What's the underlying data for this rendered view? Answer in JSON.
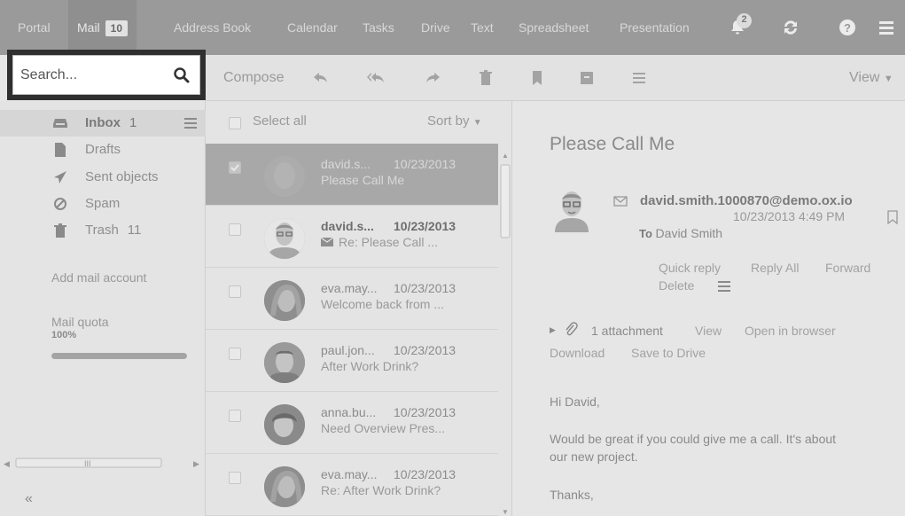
{
  "topnav": {
    "portal": "Portal",
    "mail": "Mail",
    "mail_count": "10",
    "address_book": "Address Book",
    "calendar": "Calendar",
    "tasks": "Tasks",
    "drive": "Drive",
    "text": "Text",
    "spreadsheet": "Spreadsheet",
    "presentation": "Presentation",
    "notification_count": "2",
    "icons": [
      "bell-icon",
      "refresh-icon",
      "help-icon",
      "menu-icon"
    ]
  },
  "search": {
    "placeholder": "Search..."
  },
  "toolbar": {
    "compose": "Compose",
    "view": "View",
    "icons": [
      "reply-icon",
      "reply-all-icon",
      "forward-icon",
      "delete-icon",
      "flag-icon",
      "archive-icon",
      "more-icon"
    ]
  },
  "sidebar": {
    "folders": [
      {
        "label": "Inbox",
        "count": "1",
        "icon": "inbox-icon"
      },
      {
        "label": "Drafts",
        "count": "",
        "icon": "draft-icon"
      },
      {
        "label": "Sent objects",
        "count": "",
        "icon": "sent-icon"
      },
      {
        "label": "Spam",
        "count": "",
        "icon": "spam-icon"
      },
      {
        "label": "Trash",
        "count": "11",
        "icon": "trash-icon"
      }
    ],
    "add_account": "Add mail account",
    "quota_label": "Mail quota",
    "quota_value": "100%",
    "quota_fraction": 1.0,
    "collapse": "«"
  },
  "list": {
    "select_all": "Select all",
    "sort_by": "Sort by",
    "messages": [
      {
        "from": "david.s...",
        "date": "10/23/2013",
        "subject": "Please Call Me",
        "selected": true,
        "unread": false,
        "checked": true
      },
      {
        "from": "david.s...",
        "date": "10/23/2013",
        "subject": "Re: Please Call ...",
        "selected": false,
        "unread": true,
        "checked": false
      },
      {
        "from": "eva.may...",
        "date": "10/23/2013",
        "subject": "Welcome back from ...",
        "selected": false,
        "unread": false,
        "checked": false
      },
      {
        "from": "paul.jon...",
        "date": "10/23/2013",
        "subject": "After Work Drink?",
        "selected": false,
        "unread": false,
        "checked": false
      },
      {
        "from": "anna.bu...",
        "date": "10/23/2013",
        "subject": "Need Overview Pres...",
        "selected": false,
        "unread": false,
        "checked": false
      },
      {
        "from": "eva.may...",
        "date": "10/23/2013",
        "subject": "Re: After Work Drink?",
        "selected": false,
        "unread": false,
        "checked": false
      }
    ]
  },
  "detail": {
    "subject": "Please Call Me",
    "from": "david.smith.1000870@demo.ox.io",
    "datetime": "10/23/2013 4:49 PM",
    "to_label": "To",
    "to": "David Smith",
    "actions": {
      "quick_reply": "Quick reply",
      "reply_all": "Reply All",
      "forward": "Forward",
      "delete": "Delete"
    },
    "attachment": {
      "count_text": "1 attachment",
      "view": "View",
      "open": "Open in browser",
      "download": "Download",
      "save": "Save to Drive"
    },
    "body": {
      "greeting": "Hi David,",
      "line1": "Would be great if you could give me a call. It's about",
      "line2": "our new project.",
      "closing": "Thanks,"
    }
  }
}
